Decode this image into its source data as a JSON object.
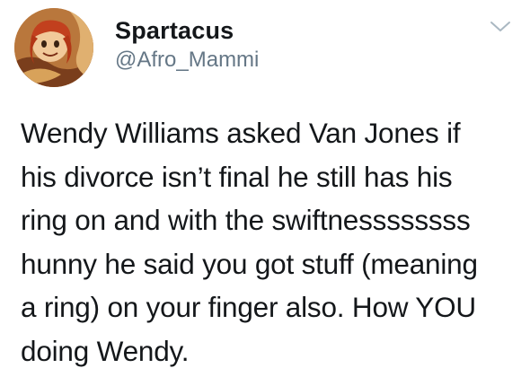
{
  "tweet": {
    "author": {
      "display_name": "Spartacus",
      "handle": "@Afro_Mammi",
      "avatar_icon": "cartoon-character-avatar"
    },
    "menu_icon": "chevron-down-icon",
    "text_lines": [
      "Wendy Williams asked Van Jones if",
      "his divorce isn’t final he still has his",
      "ring on and with the swiftnessssssss",
      "hunny he said you got stuff (meaning",
      "a ring) on your finger also. How YOU",
      "doing Wendy."
    ]
  },
  "colors": {
    "text": "#14171a",
    "secondary_text": "#657786",
    "chevron": "#aab8c2",
    "background": "#ffffff"
  }
}
